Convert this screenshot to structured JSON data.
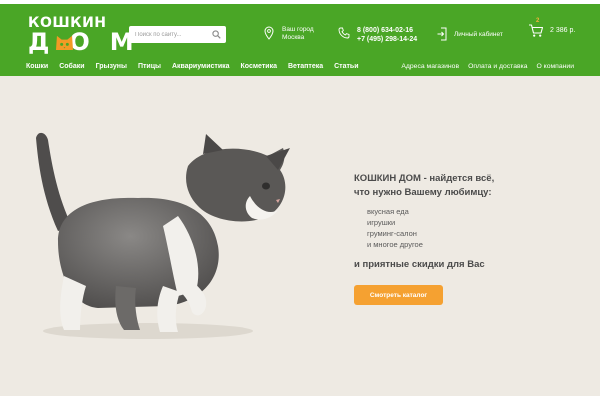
{
  "brand": {
    "name_top": "КОШКИН",
    "name_bottom": "ДОМ",
    "logo_icon": "cat-face-icon"
  },
  "search": {
    "placeholder": "Поиск по сайту...",
    "icon": "search-icon"
  },
  "location": {
    "label": "Ваш город",
    "city": "Москва",
    "icon": "location-pin-icon"
  },
  "contacts": {
    "phone1": "8 (800) 634-02-16",
    "phone2": "+7 (495) 298-14-24",
    "icon": "phone-icon"
  },
  "account": {
    "label": "Личный кабинет",
    "icon": "login-icon"
  },
  "cart": {
    "count": "2",
    "total": "2 386 р.",
    "icon": "cart-icon"
  },
  "nav": {
    "categories": [
      "Кошки",
      "Собаки",
      "Грызуны",
      "Птицы",
      "Аквариумистика",
      "Косметика",
      "Ветаптека",
      "Статьи"
    ],
    "info_links": [
      "Адреса магазинов",
      "Оплата и доставка",
      "О компании"
    ]
  },
  "hero": {
    "title_line1": "КОШКИН ДОМ - найдется всё,",
    "title_line2": "что нужно Вашему любимцу:",
    "features": [
      "вкусная еда",
      "игрушки",
      "груминг-салон",
      "и многое другое"
    ],
    "subtitle": "и приятные скидки для Вас",
    "button_label": "Смотреть каталог",
    "image": "kitten-photo"
  },
  "colors": {
    "header_green": "#4aa626",
    "accent_orange": "#f5a131",
    "hero_background": "#eeeae3",
    "text_dark": "#4b4b4b"
  }
}
